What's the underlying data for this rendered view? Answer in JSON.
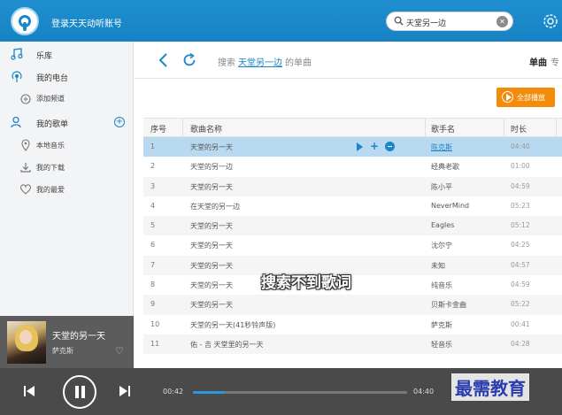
{
  "header": {
    "login_text": "登录天天动听账号",
    "search_value": "天堂另一边"
  },
  "sidebar": {
    "items": [
      {
        "label": "乐库",
        "icon": "music-note-icon"
      },
      {
        "label": "我的电台",
        "icon": "radio-icon"
      },
      {
        "label": "添加频道",
        "icon": "add-channel-icon"
      },
      {
        "label": "我的歌单",
        "icon": "user-icon"
      },
      {
        "label": "本地音乐",
        "icon": "location-icon"
      },
      {
        "label": "我的下载",
        "icon": "download-icon"
      },
      {
        "label": "我的最爱",
        "icon": "heart-icon"
      }
    ]
  },
  "now_playing": {
    "title": "天堂的另一天",
    "artist": "萨克斯"
  },
  "main": {
    "breadcrumb_prefix": "搜索",
    "breadcrumb_keyword": "天堂另一边",
    "breadcrumb_suffix": "的单曲",
    "tab_single": "单曲",
    "tab_more": "专",
    "play_all_label": "全部播放",
    "not_found_text": "搜索不到歌词"
  },
  "table": {
    "headers": {
      "index": "序号",
      "name": "歌曲名称",
      "artist": "歌手名",
      "duration": "时长"
    },
    "rows": [
      {
        "index": "1",
        "name": "天堂的另一天",
        "artist": "陈克斯",
        "duration": "04:40"
      },
      {
        "index": "2",
        "name": "天堂的另一边",
        "artist": "经典老歌",
        "duration": "01:00"
      },
      {
        "index": "3",
        "name": "天堂的另一天",
        "artist": "陈小平",
        "duration": "04:59"
      },
      {
        "index": "4",
        "name": "在天堂的另一边",
        "artist": "NeverMind",
        "duration": "05:23"
      },
      {
        "index": "5",
        "name": "天堂的另一天",
        "artist": "Eagles",
        "duration": "05:12"
      },
      {
        "index": "6",
        "name": "天堂的另一天",
        "artist": "沈尔宁",
        "duration": "04:25"
      },
      {
        "index": "7",
        "name": "天堂的另一天",
        "artist": "未知",
        "duration": "04:57"
      },
      {
        "index": "8",
        "name": "天堂的另一天",
        "artist": "纯音乐",
        "duration": "04:59"
      },
      {
        "index": "9",
        "name": "天堂的另一天",
        "artist": "贝斯卡金曲",
        "duration": "05:22"
      },
      {
        "index": "10",
        "name": "天堂的另一天(41秒铃声版)",
        "artist": "萨克斯",
        "duration": "00:41"
      },
      {
        "index": "11",
        "name": "佑 - 吉 天堂里的另一天",
        "artist": "轻音乐",
        "duration": "04:28"
      }
    ]
  },
  "player": {
    "current_time": "00:42",
    "total_time": "04:40",
    "progress_fraction": 0.15,
    "watermark": "最需教育"
  },
  "colors": {
    "header_blue": "#1682c4",
    "accent_blue": "#1b86c8",
    "play_all_orange": "#f28c0a",
    "selected_row": "#b8d9ef",
    "player_bg": "#4a4a4a"
  }
}
